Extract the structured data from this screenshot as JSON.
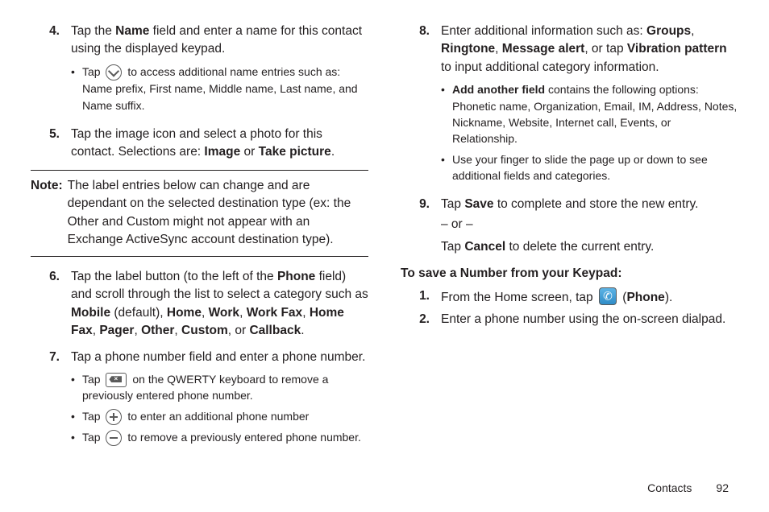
{
  "left": {
    "step4": {
      "num": "4.",
      "body_pre": "Tap the ",
      "body_b1": "Name",
      "body_post1": " field and enter a name for this contact using the displayed keypad.",
      "s1_pre": "Tap ",
      "s1_post": " to access additional name entries such as: Name prefix, First name, Middle name, Last name, and Name suffix."
    },
    "step5": {
      "num": "5.",
      "body_pre": "Tap the image icon and select a photo for this contact. Selections are: ",
      "b1": "Image",
      "mid": " or ",
      "b2": "Take picture",
      "post": "."
    },
    "note": {
      "label": "Note:",
      "body": "The label entries below can change and are dependant on the selected destination type (ex: the Other and Custom might not appear with an Exchange ActiveSync account destination type)."
    },
    "step6": {
      "num": "6.",
      "pre": "Tap the label button (to the left of the ",
      "b_phone": "Phone",
      "mid1": " field) and scroll through the list to select a category such as ",
      "b_mobile": "Mobile",
      "mid_def": " (default), ",
      "b_home": "Home",
      "c1": ", ",
      "b_work": "Work",
      "c2": ", ",
      "b_workfax": "Work Fax",
      "c3": ", ",
      "b_homefax": "Home Fax",
      "c4": ", ",
      "b_pager": "Pager",
      "c5": ", ",
      "b_other": "Other",
      "c6": ", ",
      "b_custom": "Custom",
      "c7": ", or ",
      "b_callback": "Callback",
      "post": "."
    },
    "step7": {
      "num": "7.",
      "body": "Tap a phone number field and enter a phone number.",
      "s1_pre": "Tap ",
      "s1_post": " on the QWERTY keyboard to remove a previously entered phone number.",
      "s2_pre": "Tap ",
      "s2_post": " to enter an additional phone number",
      "s3_pre": "Tap ",
      "s3_post": " to remove a previously entered phone number."
    }
  },
  "right": {
    "step8": {
      "num": "8.",
      "pre": "Enter additional information such as: ",
      "b1": "Groups",
      "c1": ", ",
      "b2": "Ringtone",
      "c2": ", ",
      "b3": "Message alert",
      "mid": ", or tap ",
      "b4": "Vibration pattern",
      "post": " to input additional category information.",
      "s1_b": "Add another field",
      "s1_post": " contains the following options: Phonetic name, Organization, Email, IM, Address, Notes, Nickname, Website, Internet call, Events, or Relationship.",
      "s2": "Use your finger to slide the page up or down to see additional fields and categories."
    },
    "step9": {
      "num": "9.",
      "pre": "Tap ",
      "b1": "Save",
      "post1": " to complete and store the new entry.",
      "or": "– or –",
      "pre2": "Tap ",
      "b2": "Cancel",
      "post2": " to delete the current entry."
    },
    "subhead": "To save a Number from your Keypad:",
    "k1": {
      "num": "1.",
      "pre": "From the Home screen, tap ",
      "mid_open": " (",
      "b": "Phone",
      "post": ")."
    },
    "k2": {
      "num": "2.",
      "body": "Enter a phone number using the on-screen dialpad."
    }
  },
  "footer": {
    "section": "Contacts",
    "page": "92"
  }
}
